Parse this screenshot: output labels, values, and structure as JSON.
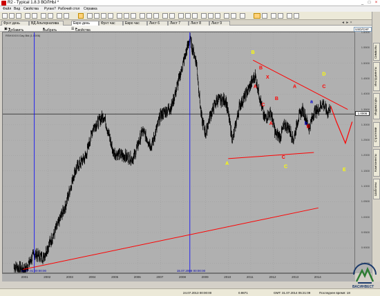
{
  "window": {
    "title": "R2 - Typical 1.8.3 ВОЛНЫ *"
  },
  "menu": [
    "Файл",
    "Вид",
    "Свойства",
    "Ругаю?",
    "Рабочий стол",
    "Справка"
  ],
  "tabs": [
    {
      "label": "Фунт день",
      "active": false
    },
    {
      "label": "ВД Альтернатива",
      "active": false
    },
    {
      "label": "Евро день",
      "active": true
    },
    {
      "label": "Фунт час",
      "active": false
    },
    {
      "label": "Евро час",
      "active": false
    },
    {
      "label": "Лист 6",
      "active": false
    },
    {
      "label": "Лист 7",
      "active": false
    },
    {
      "label": "Лист 8",
      "active": false
    },
    {
      "label": "Лист 9",
      "active": false
    }
  ],
  "chart_toolbar": {
    "add_chart": "Добавить график",
    "select": "Выбрать",
    "properties": "Свойства"
  },
  "symbol_select": "USD/CHF",
  "chart_header": "RSHXXXX Day Bid (1.0006)",
  "current_price": "1.0006",
  "right_tabs": [
    "Символы",
    "Инструменты",
    "Индикаторы",
    "Стратегии",
    "Компоненты",
    "Шаблоны"
  ],
  "status": {
    "left": "24.07.2013 00:00:00",
    "value": "0.9871",
    "time": "GMT: 31.07.2014 05:21:09",
    "last": "Последнее время: 18"
  },
  "logo": {
    "text": "ВАСИНВЕСТ"
  },
  "vlines": [
    {
      "label": "10.07.01 00:00:00"
    },
    {
      "label": "15.07.2008 00:00:00"
    }
  ],
  "colors": {
    "chart_bg": "#b0b0b0",
    "trend": "#ff0000",
    "vline": "#0000ff",
    "wave_yellow": "#ffff00",
    "wave_red": "#ff0000"
  },
  "chart_data": {
    "type": "line",
    "x_ticks": [
      "2001",
      "2002",
      "2003",
      "2004",
      "2005",
      "2006",
      "2007",
      "2008",
      "2009",
      "2010",
      "2011",
      "2012",
      "2013",
      "2014"
    ],
    "y_ticks": [
      "1.8000",
      "1.7500",
      "1.7000",
      "1.6500",
      "1.6000",
      "1.5500",
      "1.5000",
      "1.4500",
      "1.4000",
      "1.3500",
      "1.3000",
      "1.2500",
      "1.2000",
      "1.1500",
      "1.1000",
      "1.0500",
      "1.0000",
      "0.9500",
      "0.9000",
      "0.8500",
      "0.8000"
    ],
    "ylim": [
      0.82,
      1.6
    ],
    "x": [
      2000.5,
      2001.0,
      2001.4,
      2001.8,
      2002.3,
      2002.8,
      2003.2,
      2003.7,
      2004.0,
      2004.5,
      2004.9,
      2005.3,
      2005.8,
      2006.2,
      2006.6,
      2007.0,
      2007.5,
      2007.9,
      2008.3,
      2008.6,
      2008.8,
      2009.0,
      2009.2,
      2009.5,
      2009.9,
      2010.2,
      2010.5,
      2010.8,
      2011.0,
      2011.2,
      2011.35,
      2011.6,
      2011.9,
      2012.1,
      2012.3,
      2012.5,
      2012.7,
      2012.9,
      2013.1,
      2013.3,
      2013.6,
      2013.8,
      2014.0,
      2014.2,
      2014.4,
      2014.55
    ],
    "y": [
      0.84,
      0.83,
      0.88,
      0.87,
      0.95,
      1.04,
      1.15,
      1.2,
      1.29,
      1.33,
      1.21,
      1.2,
      1.19,
      1.28,
      1.23,
      1.33,
      1.36,
      1.47,
      1.58,
      1.5,
      1.33,
      1.27,
      1.33,
      1.38,
      1.38,
      1.25,
      1.36,
      1.4,
      1.43,
      1.46,
      1.41,
      1.32,
      1.34,
      1.27,
      1.26,
      1.3,
      1.29,
      1.25,
      1.32,
      1.35,
      1.29,
      1.34,
      1.35,
      1.37,
      1.34,
      1.36
    ],
    "projection": {
      "x": [
        2014.55,
        2014.8,
        2015.2,
        2015.5
      ],
      "y": [
        1.36,
        1.31,
        1.24,
        1.31
      ]
    },
    "trendlines": [
      {
        "x": [
          2000.9,
          2014.0
        ],
        "y": [
          0.83,
          1.03
        ]
      },
      {
        "x": [
          2010.0,
          2013.8
        ],
        "y": [
          1.19,
          1.21
        ]
      },
      {
        "x": [
          2011.1,
          2015.3
        ],
        "y": [
          1.51,
          1.35
        ]
      }
    ],
    "wave_labels": [
      {
        "t": "A",
        "x": 2009.95,
        "y": 1.17,
        "c": "y"
      },
      {
        "t": "B",
        "x": 2011.1,
        "y": 1.53,
        "c": "y"
      },
      {
        "t": "B",
        "x": 2011.45,
        "y": 1.48,
        "c": "r"
      },
      {
        "t": "X",
        "x": 2011.75,
        "y": 1.45,
        "c": "r"
      },
      {
        "t": "A",
        "x": 2011.2,
        "y": 1.42,
        "c": "r"
      },
      {
        "t": "C",
        "x": 2011.55,
        "y": 1.36,
        "c": "r"
      },
      {
        "t": "B",
        "x": 2012.15,
        "y": 1.38,
        "c": "r"
      },
      {
        "t": "A",
        "x": 2011.9,
        "y": 1.3,
        "c": "r"
      },
      {
        "t": "A",
        "x": 2012.95,
        "y": 1.42,
        "c": "r"
      },
      {
        "t": "C",
        "x": 2012.45,
        "y": 1.19,
        "c": "r"
      },
      {
        "t": "C",
        "x": 2012.55,
        "y": 1.16,
        "c": "y"
      },
      {
        "t": "D",
        "x": 2014.25,
        "y": 1.46,
        "c": "y"
      },
      {
        "t": "C",
        "x": 2014.25,
        "y": 1.42,
        "c": "r"
      },
      {
        "t": "E",
        "x": 2015.15,
        "y": 1.15,
        "c": "y"
      },
      {
        "t": "a",
        "x": 2013.7,
        "y": 1.37,
        "c": "b"
      },
      {
        "t": "b",
        "x": 2013.45,
        "y": 1.3,
        "c": "b"
      },
      {
        "t": "B",
        "x": 2013.55,
        "y": 1.29,
        "c": "r"
      }
    ]
  }
}
